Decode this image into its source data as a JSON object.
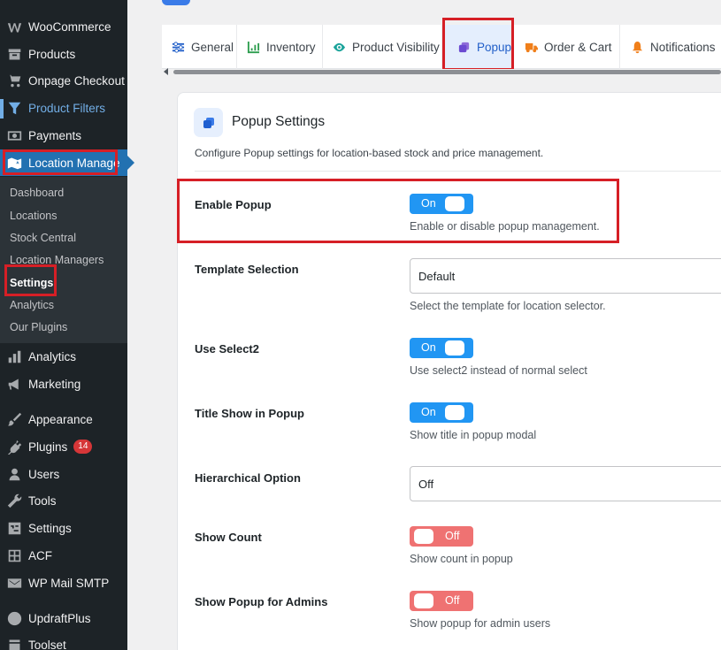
{
  "sidebar": {
    "items": [
      {
        "label": "WooCommerce",
        "icon": "woo-icon"
      },
      {
        "label": "Products",
        "icon": "archive-icon"
      },
      {
        "label": "Onpage Checkout",
        "icon": "cart-icon"
      },
      {
        "label": "Product Filters",
        "icon": "filter-icon"
      },
      {
        "label": "Payments",
        "icon": "money-icon"
      },
      {
        "label": "Location Manage",
        "icon": "map-icon"
      }
    ],
    "submenu": [
      {
        "label": "Dashboard"
      },
      {
        "label": "Locations"
      },
      {
        "label": "Stock Central"
      },
      {
        "label": "Location Managers"
      },
      {
        "label": "Settings"
      },
      {
        "label": "Analytics"
      },
      {
        "label": "Our Plugins"
      }
    ],
    "items2": [
      {
        "label": "Analytics",
        "icon": "bar-chart-icon"
      },
      {
        "label": "Marketing",
        "icon": "megaphone-icon"
      },
      {
        "label": "Appearance",
        "icon": "brush-icon"
      },
      {
        "label": "Plugins",
        "icon": "plugin-icon",
        "badge": "14"
      },
      {
        "label": "Users",
        "icon": "user-icon"
      },
      {
        "label": "Tools",
        "icon": "wrench-icon"
      },
      {
        "label": "Settings",
        "icon": "settings-icon"
      },
      {
        "label": "ACF",
        "icon": "acf-icon"
      },
      {
        "label": "WP Mail SMTP",
        "icon": "mail-icon"
      },
      {
        "label": "UpdraftPlus",
        "icon": "updraft-icon"
      },
      {
        "label": "Toolset",
        "icon": "toolset-icon"
      }
    ]
  },
  "tabs": [
    {
      "label": "General",
      "icon": "sliders-icon"
    },
    {
      "label": "Inventory",
      "icon": "inventory-chart-icon"
    },
    {
      "label": "Product Visibility",
      "icon": "eye-icon"
    },
    {
      "label": "Popup",
      "icon": "window-icon"
    },
    {
      "label": "Order & Cart",
      "icon": "truck-icon"
    },
    {
      "label": "Notifications",
      "icon": "bell-icon"
    }
  ],
  "card": {
    "title": "Popup Settings",
    "description": "Configure Popup settings for location-based stock and price management."
  },
  "settings": {
    "enable_popup": {
      "label": "Enable Popup",
      "state": "On",
      "help": "Enable or disable popup management."
    },
    "template_selection": {
      "label": "Template Selection",
      "value": "Default",
      "help": "Select the template for location selector."
    },
    "use_select2": {
      "label": "Use Select2",
      "state": "On",
      "help": "Use select2 instead of normal select"
    },
    "title_show": {
      "label": "Title Show in Popup",
      "state": "On",
      "help": "Show title in popup modal"
    },
    "hierarchical": {
      "label": "Hierarchical Option",
      "value": "Off"
    },
    "show_count": {
      "label": "Show Count",
      "state": "Off",
      "help": "Show count in popup"
    },
    "show_admins": {
      "label": "Show Popup for Admins",
      "state": "Off",
      "help": "Show popup for admin users"
    }
  },
  "colors": {
    "accent": "#2196f3",
    "off": "#ef7272",
    "highlight": "#d61f26",
    "sidebar": "#1d2327"
  }
}
